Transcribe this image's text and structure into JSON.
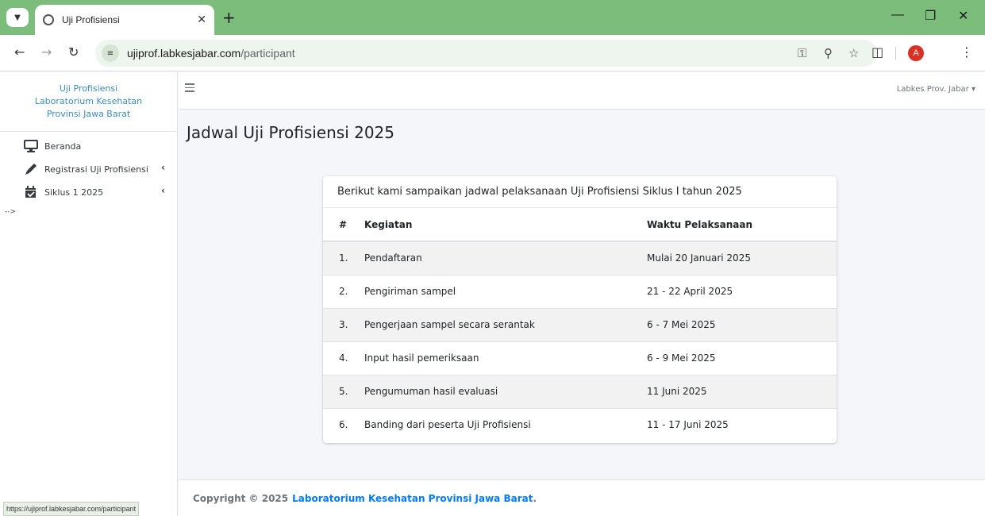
{
  "browser": {
    "tab_title": "Uji Profisiensi",
    "url_host": "ujiprof.labkesjabar.com",
    "url_path": "/participant",
    "status_url": "https://ujiprof.labkesjabar.com/participant",
    "profile_initial": "A"
  },
  "sidebar": {
    "brand": "Uji Profisiensi Laboratorium Kesehatan Provinsi Jawa Barat",
    "items": [
      {
        "label": "Beranda",
        "icon": "monitor-icon"
      },
      {
        "label": "Registrasi Uji Profisiensi",
        "icon": "pen-icon",
        "has_submenu": true
      },
      {
        "label": "Siklus 1 2025",
        "icon": "calendar-check-icon",
        "has_submenu": true
      }
    ],
    "stray_text": "-->"
  },
  "topnav": {
    "user": "Labkes Prov. Jabar"
  },
  "page": {
    "title": "Jadwal Uji Profisiensi 2025"
  },
  "card": {
    "header": "Berikut kami sampaikan jadwal pelaksanaan Uji Profisiensi Siklus I tahun 2025",
    "columns": [
      "#",
      "Kegiatan",
      "Waktu Pelaksanaan"
    ],
    "rows": [
      {
        "no": "1.",
        "kegiatan": "Pendaftaran",
        "waktu": "Mulai 20 Januari 2025"
      },
      {
        "no": "2.",
        "kegiatan": "Pengiriman sampel",
        "waktu": "21 - 22 April 2025"
      },
      {
        "no": "3.",
        "kegiatan": "Pengerjaan sampel secara serantak",
        "waktu": "6 - 7 Mei 2025"
      },
      {
        "no": "4.",
        "kegiatan": "Input hasil pemeriksaan",
        "waktu": "6 - 9 Mei 2025"
      },
      {
        "no": "5.",
        "kegiatan": "Pengumuman hasil evaluasi",
        "waktu": "11 Juni 2025"
      },
      {
        "no": "6.",
        "kegiatan": "Banding dari peserta Uji Profisiensi",
        "waktu": "11 - 17 Juni 2025"
      }
    ]
  },
  "footer": {
    "prefix": "Copyright © 2025",
    "link": "Laboratorium Kesehatan Provinsi Jawa Barat",
    "suffix": "."
  },
  "colors": {
    "chrome_green": "#7cbd7c",
    "brand_blue": "#3c8dbc",
    "link_blue": "#007bff"
  }
}
